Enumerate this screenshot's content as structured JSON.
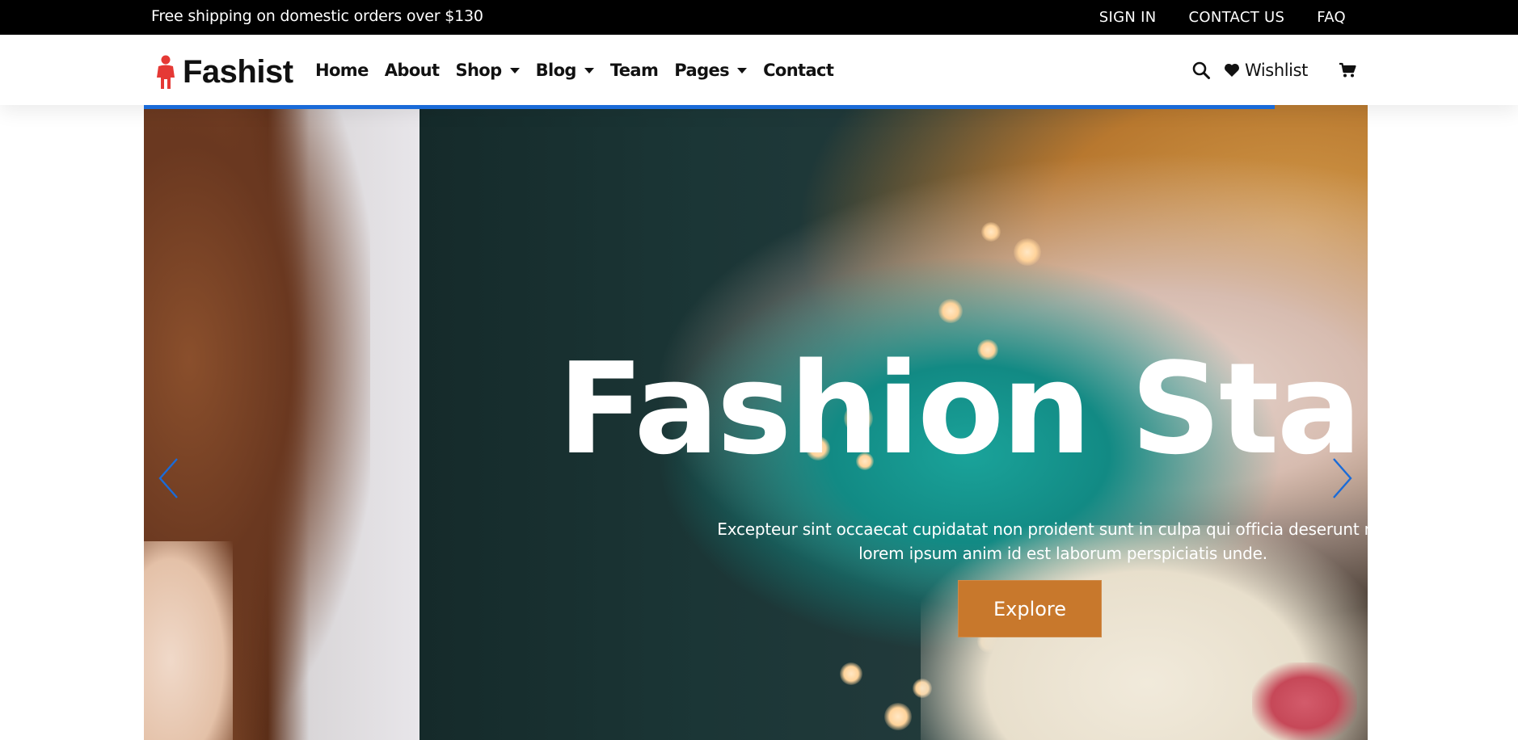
{
  "topbar": {
    "promo": "Free shipping on domestic orders over $130",
    "links": [
      "SIGN IN",
      "CONTACT US",
      "FAQ"
    ]
  },
  "header": {
    "brand": "Fashist",
    "nav": [
      {
        "label": "Home",
        "dropdown": false
      },
      {
        "label": "About",
        "dropdown": false
      },
      {
        "label": "Shop",
        "dropdown": true
      },
      {
        "label": "Blog",
        "dropdown": true
      },
      {
        "label": "Team",
        "dropdown": false
      },
      {
        "label": "Pages",
        "dropdown": true
      },
      {
        "label": "Contact",
        "dropdown": false
      }
    ],
    "wishlist_label": "Wishlist",
    "icons": [
      "search-icon",
      "heart-icon",
      "cart-icon"
    ]
  },
  "hero": {
    "title": "Fashion Star",
    "text": "Excepteur sint occaecat cupidatat non proident sunt in culpa qui officia deserunt mollit lorem ipsum anim id est laborum perspiciatis unde.",
    "button_label": "Explore"
  },
  "colors": {
    "topbar_bg": "#000000",
    "accent_blue": "#1a6bd8",
    "button": "#c8782c",
    "logo_red": "#e53935"
  }
}
